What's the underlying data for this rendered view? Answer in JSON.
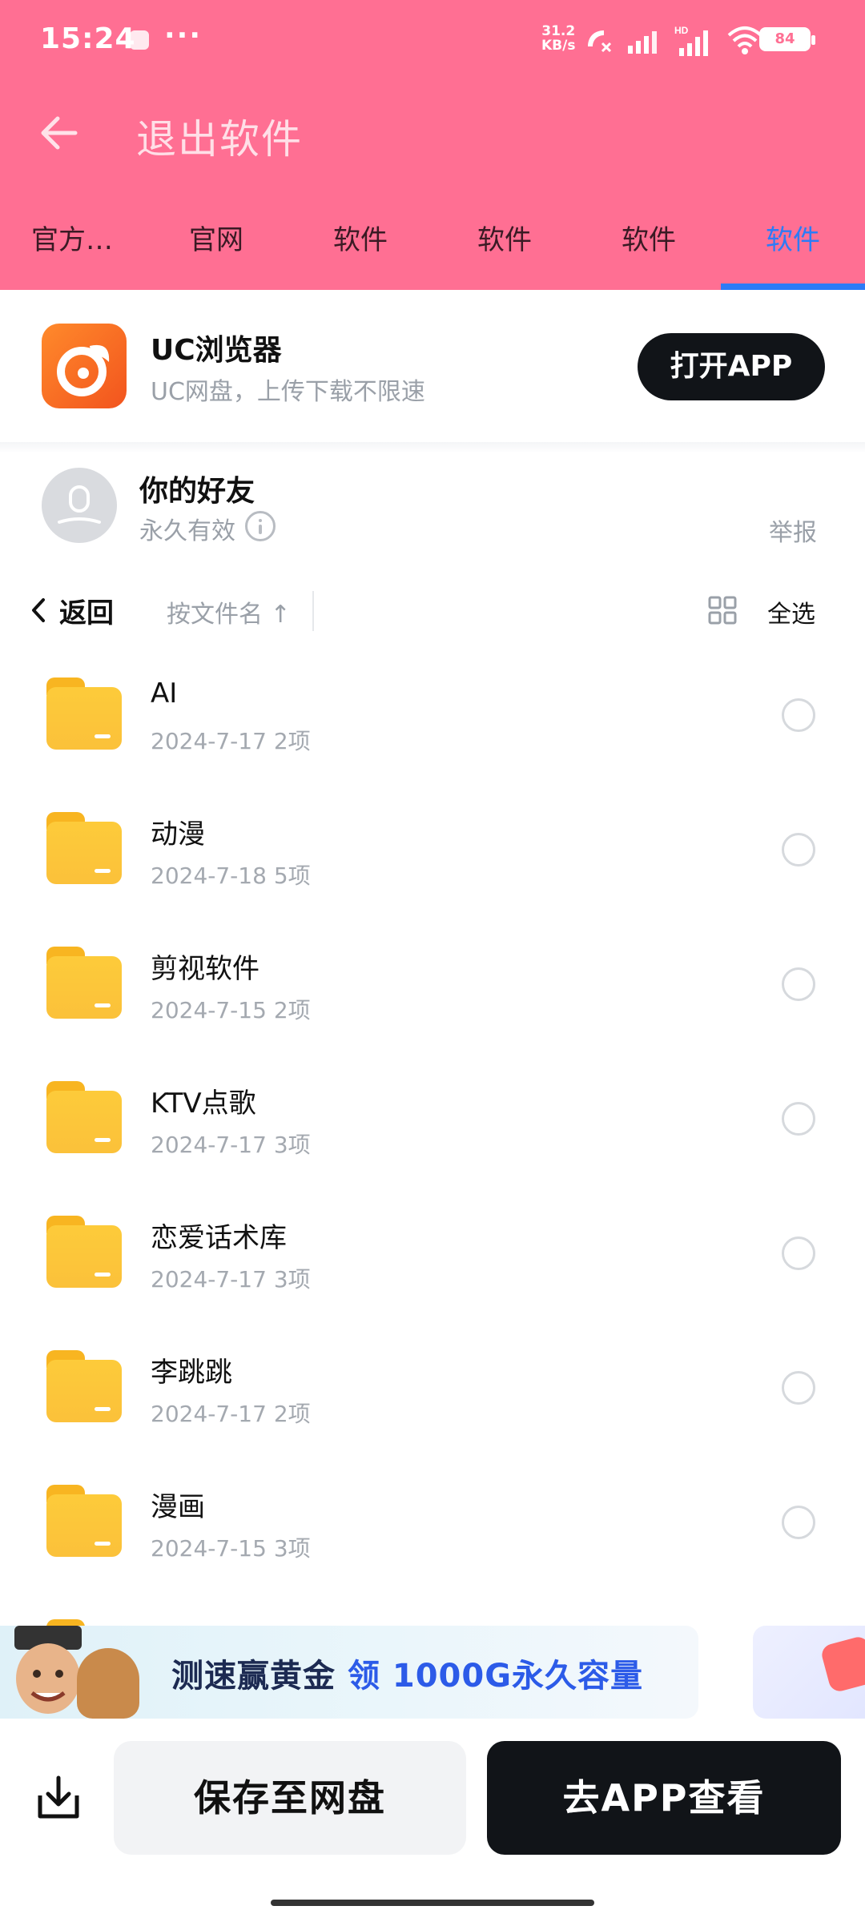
{
  "status_bar": {
    "time": "15:24",
    "more": "···",
    "speed_value": "31.2",
    "speed_unit": "KB/s",
    "battery": "84",
    "icons": [
      "call-muted-icon",
      "signal-icon",
      "hd-signal-icon",
      "wifi-icon",
      "battery-icon"
    ]
  },
  "title_bar": {
    "title": "退出软件"
  },
  "tabs": [
    {
      "label": "官方…"
    },
    {
      "label": "官网"
    },
    {
      "label": "软件"
    },
    {
      "label": "软件"
    },
    {
      "label": "软件"
    },
    {
      "label": "软件",
      "active": true
    }
  ],
  "promo": {
    "app_name": "UC浏览器",
    "description": "UC网盘，上传下载不限速",
    "open_button": "打开APP"
  },
  "sharer": {
    "name": "你的好友",
    "validity": "永久有效",
    "report": "举报"
  },
  "toolbar": {
    "back_label": "返回",
    "sort_label": "按文件名 ↑",
    "select_all": "全选"
  },
  "files": [
    {
      "name": "AI",
      "date": "2024-7-17",
      "count": "2项"
    },
    {
      "name": "动漫",
      "date": "2024-7-18",
      "count": "5项"
    },
    {
      "name": "剪视软件",
      "date": "2024-7-15",
      "count": "2项"
    },
    {
      "name": "KTV点歌",
      "date": "2024-7-17",
      "count": "3项"
    },
    {
      "name": "恋爱话术库",
      "date": "2024-7-17",
      "count": "3项"
    },
    {
      "name": "李跳跳",
      "date": "2024-7-17",
      "count": "2项"
    },
    {
      "name": "漫画",
      "date": "2024-7-15",
      "count": "3项"
    }
  ],
  "banner": {
    "text_part1": "测速赢黄金",
    "text_part2": "领\n1000G永久容量"
  },
  "bottom": {
    "save_button": "保存至网盘",
    "view_button": "去APP查看"
  },
  "colors": {
    "header_bg": "#FF6F93",
    "tab_active": "#2D7BF6",
    "folder": "#FBC13A",
    "dark_button": "#111418"
  }
}
